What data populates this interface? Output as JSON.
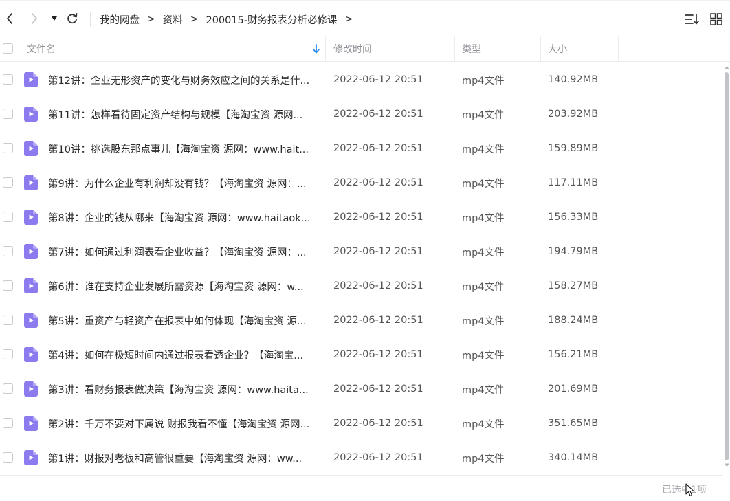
{
  "toolbar": {
    "back_icon": "chevron-left-icon",
    "forward_icon": "chevron-right-icon",
    "dropdown_icon": "caret-down-icon",
    "refresh_icon": "refresh-icon",
    "sort_icon": "sort-list-icon",
    "grid_icon": "grid-view-icon"
  },
  "breadcrumb": {
    "items": [
      "我的网盘",
      "资料",
      "200015-财务报表分析必修课"
    ],
    "separator": ">"
  },
  "columns": {
    "name": "文件名",
    "modified": "修改时间",
    "type": "类型",
    "size": "大小"
  },
  "files": [
    {
      "name": "第12讲：企业无形资产的变化与财务效应之间的关系是什...",
      "modified": "2022-06-12 20:51",
      "type": "mp4文件",
      "size": "140.92MB"
    },
    {
      "name": "第11讲：怎样看待固定资产结构与规模【海淘宝资 源网...",
      "modified": "2022-06-12 20:51",
      "type": "mp4文件",
      "size": "203.92MB"
    },
    {
      "name": "第10讲：挑选股东那点事儿【海淘宝资 源网：www.hait...",
      "modified": "2022-06-12 20:51",
      "type": "mp4文件",
      "size": "159.89MB"
    },
    {
      "name": "第9讲：为什么企业有利润却没有钱？【海淘宝资 源网：...",
      "modified": "2022-06-12 20:51",
      "type": "mp4文件",
      "size": "117.11MB"
    },
    {
      "name": "第8讲：企业的钱从哪来【海淘宝资 源网：www.haitaok...",
      "modified": "2022-06-12 20:51",
      "type": "mp4文件",
      "size": "156.33MB"
    },
    {
      "name": "第7讲：如何通过利润表看企业收益？【海淘宝资 源网：...",
      "modified": "2022-06-12 20:51",
      "type": "mp4文件",
      "size": "194.79MB"
    },
    {
      "name": "第6讲：谁在支持企业发展所需资源【海淘宝资 源网：w...",
      "modified": "2022-06-12 20:51",
      "type": "mp4文件",
      "size": "158.27MB"
    },
    {
      "name": "第5讲：重资产与轻资产在报表中如何体现【海淘宝资 源...",
      "modified": "2022-06-12 20:51",
      "type": "mp4文件",
      "size": "188.24MB"
    },
    {
      "name": "第4讲：如何在极短时间内通过报表看透企业？【海淘宝...",
      "modified": "2022-06-12 20:51",
      "type": "mp4文件",
      "size": "156.21MB"
    },
    {
      "name": "第3讲：看财务报表做决策【海淘宝资 源网：www.haita...",
      "modified": "2022-06-12 20:51",
      "type": "mp4文件",
      "size": "201.69MB"
    },
    {
      "name": "第2讲：千万不要对下属说 财报我看不懂【海淘宝资 源网...",
      "modified": "2022-06-12 20:51",
      "type": "mp4文件",
      "size": "351.65MB"
    },
    {
      "name": "第1讲：财报对老板和高管很重要【海淘宝资 源网：ww...",
      "modified": "2022-06-12 20:51",
      "type": "mp4文件",
      "size": "340.14MB"
    }
  ],
  "status": {
    "selection_text": "已选中1项"
  },
  "colors": {
    "video_icon": "#8b7bef",
    "sort_arrow": "#2e8cf0",
    "border": "#ececef"
  }
}
